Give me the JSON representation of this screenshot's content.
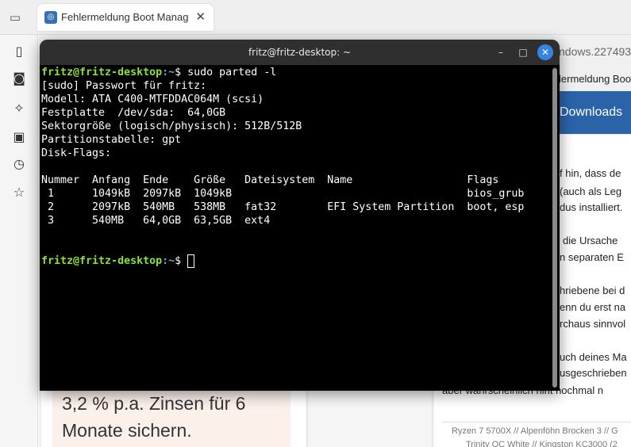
{
  "browser": {
    "tab_title": "Fehlermeldung Boot Manag",
    "tab_close": "✕",
    "address_fragment": "ndows.227493",
    "tab_fragment": "lermeldung Boo",
    "downloads_label": "Downloads"
  },
  "sidebar": {
    "icons": [
      "sidebar-panel-icon",
      "camera-icon",
      "extensions-icon",
      "synced-devices-icon",
      "history-icon",
      "bookmarks-star-icon"
    ]
  },
  "article": {
    "fragments": [
      "f hin, dass de",
      "(auch als Leg",
      "dus installiert.",
      "die Ursache",
      "n separaten E",
      "hriebene bei d",
      "enn du erst na",
      "rchaus sinnvol",
      "uch deines Ma",
      "usgeschrieben",
      "aber wahrscheinlich nint nochmal n"
    ],
    "signature_1": "Ryzen 7 5700X // Alpenföhn Brocken 3 // G",
    "signature_2": "Trinity OC White // Kingston KC3000 (2"
  },
  "ad": {
    "text_line1": "3,2 % p.a. Zinsen für 6",
    "text_line2": "Monate sichern."
  },
  "terminal": {
    "title": "fritz@fritz-desktop: ~",
    "prompt_user": "fritz@fritz-desktop",
    "prompt_path": ":~",
    "prompt_symbol": "$ ",
    "command": "sudo parted -l",
    "output_lines": [
      "[sudo] Passwort für fritz:",
      "Modell: ATA C400-MTFDDAC064M (scsi)",
      "Festplatte  /dev/sda:  64,0GB",
      "Sektorgröße (logisch/physisch): 512B/512B",
      "Partitionstabelle: gpt",
      "Disk-Flags:"
    ],
    "table_headers": [
      "Nummer",
      "Anfang",
      "Ende",
      "Größe",
      "Dateisystem",
      "Name",
      "Flags"
    ],
    "table_rows": [
      [
        " 1",
        "1049kB",
        "2097kB",
        "1049kB",
        "",
        "",
        "bios_grub"
      ],
      [
        " 2",
        "2097kB",
        "540MB",
        "538MB",
        "fat32",
        "EFI System Partition",
        "boot, esp"
      ],
      [
        " 3",
        "540MB",
        "64,0GB",
        "63,5GB",
        "ext4",
        "",
        ""
      ]
    ],
    "minimize": "–",
    "maximize": "□",
    "close": "✕"
  }
}
